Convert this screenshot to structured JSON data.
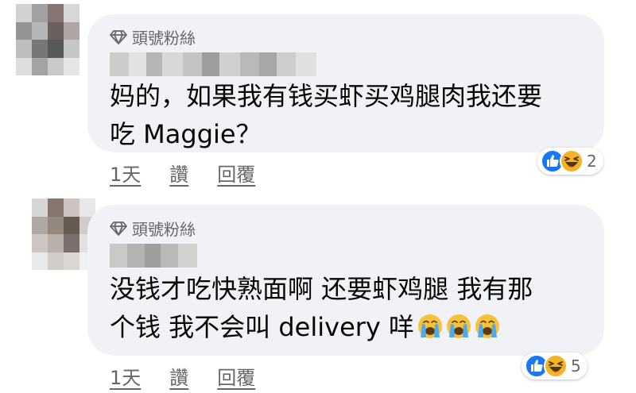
{
  "comments": [
    {
      "badge": "頭號粉絲",
      "text_line1": "妈的，如果我有钱买虾买鸡腿肉我还要",
      "text_line2": "吃 Maggie？",
      "time": "1天",
      "like": "讚",
      "reply": "回覆",
      "reaction_count": "2",
      "reaction_icons": [
        "like-icon",
        "haha-icon"
      ]
    },
    {
      "badge": "頭號粉絲",
      "text_line1": "没钱才吃快熟面啊 还要虾鸡腿 我有那",
      "text_line2": "个钱 我不会叫 delivery 咩",
      "trailing_emojis": [
        "crying-face-icon",
        "crying-face-icon",
        "crying-face-icon"
      ],
      "time": "1天",
      "like": "讚",
      "reply": "回覆",
      "reaction_count": "5",
      "reaction_icons": [
        "like-icon",
        "haha-icon"
      ]
    }
  ],
  "colors": {
    "bubble": "#f0f2f5",
    "secondary_text": "#65676b",
    "like_blue": "#1877f2",
    "haha_yellow": "#f7b125"
  }
}
